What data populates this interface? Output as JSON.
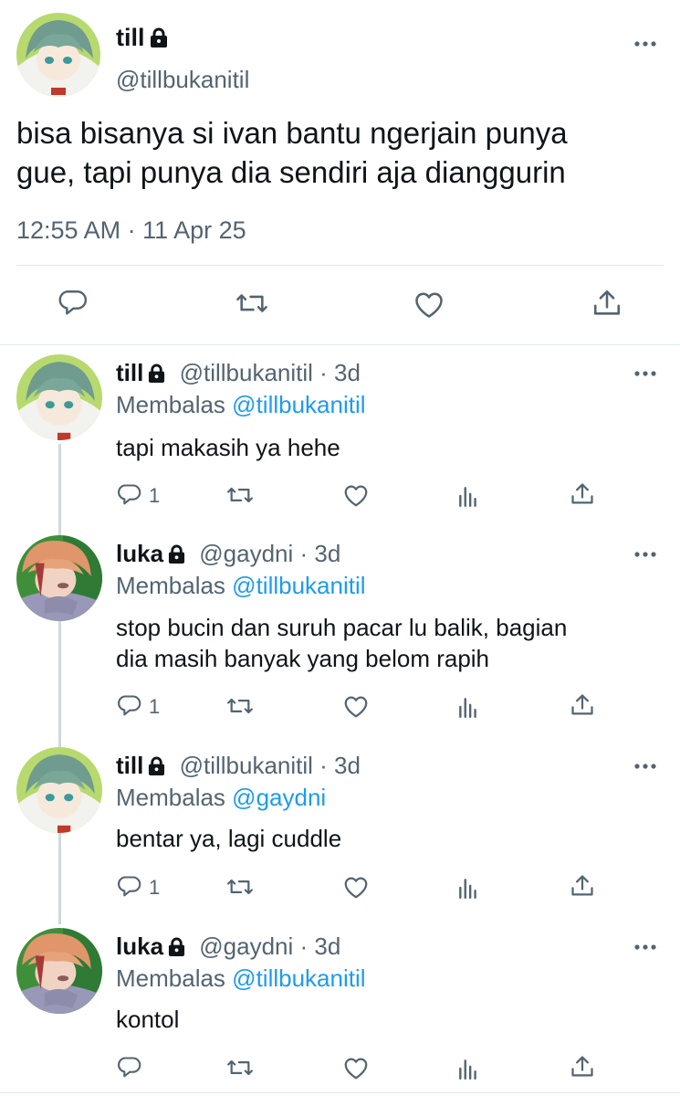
{
  "main_tweet": {
    "name": "till",
    "handle": "@tillbukanitil",
    "text_line1": "bisa bisanya si ivan bantu ngerjain punya",
    "text_line2": "gue, tapi punya dia sendiri aja dianggurin",
    "timestamp": "12:55 AM · 11 Apr 25"
  },
  "replies": [
    {
      "name": "till",
      "handle": "@tillbukanitil",
      "age": "3d",
      "replying_label": "Membalas",
      "replying_to": "@tillbukanitil",
      "text_line1": "tapi makasih ya hehe",
      "text_line2": "",
      "reply_count": "1"
    },
    {
      "name": "luka",
      "handle": "@gaydni",
      "age": "3d",
      "replying_label": "Membalas",
      "replying_to": "@tillbukanitil",
      "text_line1": "stop bucin dan suruh pacar lu balik, bagian",
      "text_line2": "dia masih banyak yang belom rapih",
      "reply_count": "1"
    },
    {
      "name": "till",
      "handle": "@tillbukanitil",
      "age": "3d",
      "replying_label": "Membalas",
      "replying_to": "@gaydni",
      "text_line1": "bentar ya, lagi cuddle",
      "text_line2": "",
      "reply_count": "1"
    },
    {
      "name": "luka",
      "handle": "@gaydni",
      "age": "3d",
      "replying_label": "Membalas",
      "replying_to": "@tillbukanitil",
      "text_line1": "kontol",
      "text_line2": "",
      "reply_count": ""
    }
  ],
  "colors": {
    "text": "#0f1419",
    "secondary": "#536471",
    "accent": "#1d9bf0",
    "divider": "#e1e8ed"
  },
  "icons": {
    "reply": "reply-icon",
    "retweet": "retweet-icon",
    "like": "heart-icon",
    "views": "views-icon",
    "share": "share-icon",
    "more": "more-icon",
    "protected": "lock-icon"
  }
}
